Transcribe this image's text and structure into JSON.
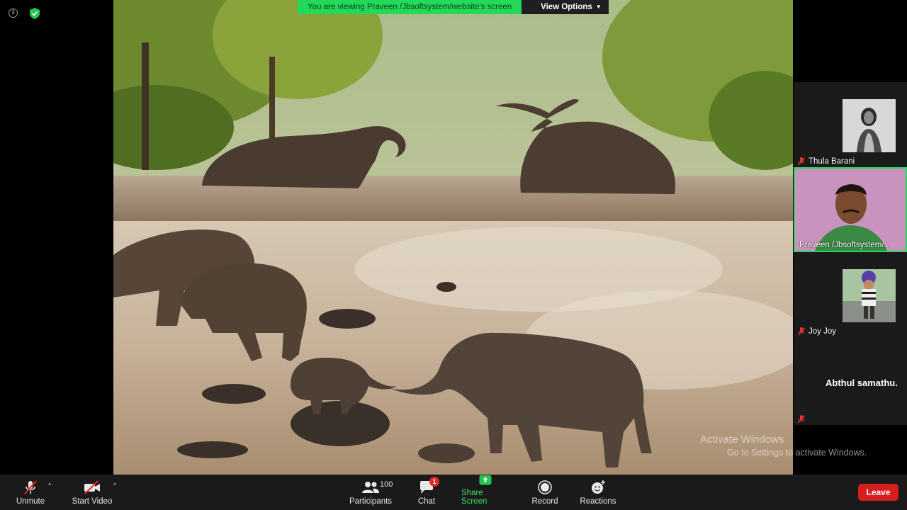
{
  "banner": {
    "viewing_text": "You are viewing Praveen /Jbsoftsystem/website's screen",
    "options_label": "View Options"
  },
  "shared_screen": {
    "image_subject": "elephants-in-river-photo"
  },
  "participants_panel": {
    "tiles": [
      {
        "name": "Thula Barani",
        "muted": true
      },
      {
        "name": "Praveen /Jbsoftsystem/...",
        "muted": false,
        "active_speaker": true
      },
      {
        "name": "Joy Joy",
        "muted": true
      },
      {
        "name": "Abthul samathu.",
        "muted": true,
        "video_off": true
      }
    ]
  },
  "watermark": {
    "line1": "Activate Windows",
    "line2": "Go to Settings to activate Windows."
  },
  "toolbar": {
    "unmute_label": "Unmute",
    "start_video_label": "Start Video",
    "participants_label": "Participants",
    "participants_count": "100",
    "chat_label": "Chat",
    "chat_badge": "1",
    "share_label": "Share Screen",
    "record_label": "Record",
    "reactions_label": "Reactions",
    "leave_label": "Leave"
  },
  "colors": {
    "accent_green": "#23d959",
    "leave_red": "#d61e1e",
    "toolbar_bg": "#1a1a1a"
  }
}
